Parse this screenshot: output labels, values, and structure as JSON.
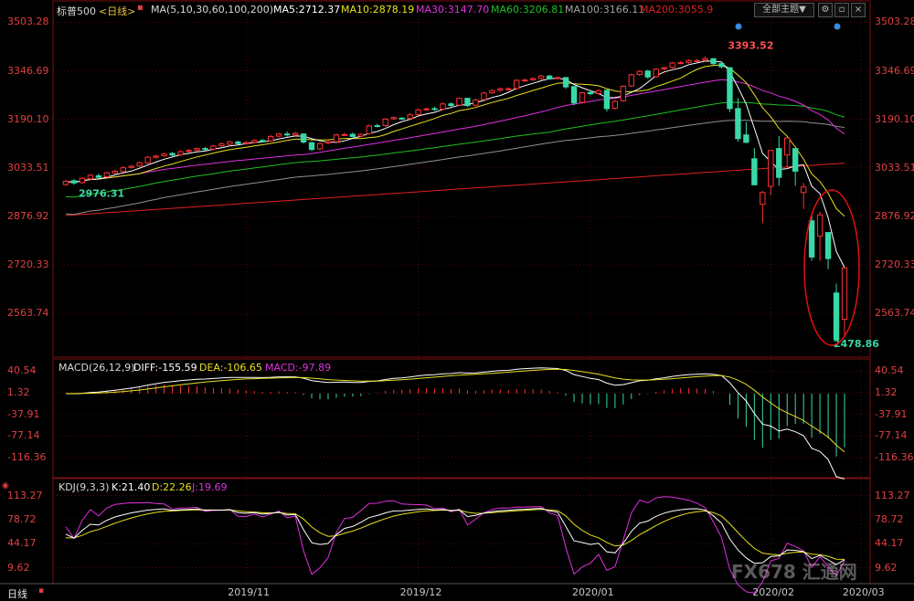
{
  "header": {
    "symbol": "标普500",
    "period": "<日线>",
    "ma_spec": "MA(5,10,30,60,100,200)",
    "ma5": "MA5:2712.37",
    "ma10": "MA10:2878.19",
    "ma30": "MA30:3147.70",
    "ma60": "MA60:3206.81",
    "ma100": "MA100:3166.11",
    "ma200": "MA200:3055.9",
    "theme_button": "全部主题",
    "theme_arrow": "▼"
  },
  "macd_header": {
    "spec": "MACD(26,12,9)",
    "diff": "DIFF:-155.59",
    "dea": "DEA:-106.65",
    "macd": "MACD:-97.89"
  },
  "kdj_header": {
    "spec": "KDJ(9,3,3)",
    "k": "K:21.40",
    "d": "D:22.26",
    "j": "J:19.69"
  },
  "footer": {
    "period_tab": "日线",
    "watermark": "FX678 汇通网"
  },
  "colors": {
    "up": "#ff3232",
    "down": "#38d8a8",
    "ma5": "#ffffff",
    "ma10": "#e8e020",
    "ma30": "#e030e0",
    "ma60": "#20c020",
    "ma100": "#909090",
    "ma200": "#e02020",
    "axis_text": "#e04040",
    "grid": "#7a1010"
  },
  "chart_data": [
    {
      "type": "candlestick",
      "title": "标普500 日线",
      "x": [
        "2019/11",
        "2019/12",
        "2020/01",
        "2020/02",
        "2020/03"
      ],
      "y_ticks": [
        3503.28,
        3346.69,
        3190.1,
        3033.51,
        2876.92,
        2720.33,
        2563.74
      ],
      "ylim": [
        2420,
        3540
      ],
      "annotations": [
        {
          "label": "3393.52",
          "value": 3393.52,
          "kind": "high"
        },
        {
          "label": "2976.31",
          "value": 2976.31,
          "kind": "low"
        },
        {
          "label": "2478.86",
          "value": 2478.86,
          "kind": "low"
        }
      ],
      "candles": [
        {
          "o": 2980,
          "c": 2990,
          "h": 2995,
          "l": 2976
        },
        {
          "o": 2992,
          "c": 2985,
          "h": 2998,
          "l": 2979
        },
        {
          "o": 2986,
          "c": 3000,
          "h": 3004,
          "l": 2983
        },
        {
          "o": 2998,
          "c": 3010,
          "h": 3014,
          "l": 2994
        },
        {
          "o": 3008,
          "c": 3003,
          "h": 3015,
          "l": 2999
        },
        {
          "o": 3005,
          "c": 3018,
          "h": 3022,
          "l": 3002
        },
        {
          "o": 3017,
          "c": 3023,
          "h": 3027,
          "l": 3013
        },
        {
          "o": 3022,
          "c": 3034,
          "h": 3039,
          "l": 3019
        },
        {
          "o": 3035,
          "c": 3039,
          "h": 3043,
          "l": 3031
        },
        {
          "o": 3040,
          "c": 3050,
          "h": 3054,
          "l": 3036
        },
        {
          "o": 3050,
          "c": 3068,
          "h": 3071,
          "l": 3046
        },
        {
          "o": 3068,
          "c": 3072,
          "h": 3076,
          "l": 3063
        },
        {
          "o": 3073,
          "c": 3079,
          "h": 3082,
          "l": 3069
        },
        {
          "o": 3080,
          "c": 3075,
          "h": 3085,
          "l": 3071
        },
        {
          "o": 3076,
          "c": 3086,
          "h": 3090,
          "l": 3072
        },
        {
          "o": 3088,
          "c": 3090,
          "h": 3094,
          "l": 3083
        },
        {
          "o": 3091,
          "c": 3096,
          "h": 3099,
          "l": 3087
        },
        {
          "o": 3096,
          "c": 3093,
          "h": 3101,
          "l": 3088
        },
        {
          "o": 3094,
          "c": 3104,
          "h": 3108,
          "l": 3090
        },
        {
          "o": 3105,
          "c": 3111,
          "h": 3115,
          "l": 3101
        },
        {
          "o": 3110,
          "c": 3118,
          "h": 3121,
          "l": 3106
        },
        {
          "o": 3117,
          "c": 3112,
          "h": 3122,
          "l": 3108
        },
        {
          "o": 3112,
          "c": 3115,
          "h": 3120,
          "l": 3108
        },
        {
          "o": 3116,
          "c": 3122,
          "h": 3126,
          "l": 3112
        },
        {
          "o": 3122,
          "c": 3120,
          "h": 3127,
          "l": 3116
        },
        {
          "o": 3121,
          "c": 3135,
          "h": 3140,
          "l": 3118
        },
        {
          "o": 3136,
          "c": 3143,
          "h": 3147,
          "l": 3132
        },
        {
          "o": 3143,
          "c": 3140,
          "h": 3151,
          "l": 3135
        },
        {
          "o": 3140,
          "c": 3145,
          "h": 3150,
          "l": 3136
        },
        {
          "o": 3143,
          "c": 3117,
          "h": 3145,
          "l": 3112
        },
        {
          "o": 3115,
          "c": 3093,
          "h": 3118,
          "l": 3088
        },
        {
          "o": 3095,
          "c": 3112,
          "h": 3116,
          "l": 3090
        },
        {
          "o": 3114,
          "c": 3118,
          "h": 3122,
          "l": 3110
        },
        {
          "o": 3118,
          "c": 3140,
          "h": 3144,
          "l": 3115
        },
        {
          "o": 3141,
          "c": 3141,
          "h": 3147,
          "l": 3136
        },
        {
          "o": 3142,
          "c": 3135,
          "h": 3148,
          "l": 3132
        },
        {
          "o": 3136,
          "c": 3142,
          "h": 3146,
          "l": 3132
        },
        {
          "o": 3144,
          "c": 3169,
          "h": 3173,
          "l": 3141
        },
        {
          "o": 3170,
          "c": 3168,
          "h": 3176,
          "l": 3164
        },
        {
          "o": 3170,
          "c": 3191,
          "h": 3195,
          "l": 3166
        },
        {
          "o": 3192,
          "c": 3196,
          "h": 3199,
          "l": 3188
        },
        {
          "o": 3194,
          "c": 3192,
          "h": 3198,
          "l": 3189
        },
        {
          "o": 3193,
          "c": 3205,
          "h": 3209,
          "l": 3190
        },
        {
          "o": 3206,
          "c": 3221,
          "h": 3225,
          "l": 3203
        },
        {
          "o": 3222,
          "c": 3224,
          "h": 3228,
          "l": 3219
        },
        {
          "o": 3225,
          "c": 3222,
          "h": 3231,
          "l": 3217
        },
        {
          "o": 3223,
          "c": 3240,
          "h": 3244,
          "l": 3220
        },
        {
          "o": 3240,
          "c": 3235,
          "h": 3245,
          "l": 3230
        },
        {
          "o": 3236,
          "c": 3258,
          "h": 3261,
          "l": 3233
        },
        {
          "o": 3258,
          "c": 3235,
          "h": 3260,
          "l": 3230
        },
        {
          "o": 3236,
          "c": 3253,
          "h": 3257,
          "l": 3232
        },
        {
          "o": 3254,
          "c": 3275,
          "h": 3279,
          "l": 3251
        },
        {
          "o": 3276,
          "c": 3283,
          "h": 3287,
          "l": 3272
        },
        {
          "o": 3284,
          "c": 3289,
          "h": 3293,
          "l": 3280
        },
        {
          "o": 3289,
          "c": 3289,
          "h": 3294,
          "l": 3284
        },
        {
          "o": 3290,
          "c": 3316,
          "h": 3320,
          "l": 3286
        },
        {
          "o": 3317,
          "c": 3317,
          "h": 3322,
          "l": 3312
        },
        {
          "o": 3318,
          "c": 3322,
          "h": 3326,
          "l": 3314
        },
        {
          "o": 3322,
          "c": 3330,
          "h": 3334,
          "l": 3318
        },
        {
          "o": 3330,
          "c": 3321,
          "h": 3334,
          "l": 3317
        },
        {
          "o": 3322,
          "c": 3325,
          "h": 3329,
          "l": 3318
        },
        {
          "o": 3325,
          "c": 3295,
          "h": 3327,
          "l": 3289
        },
        {
          "o": 3296,
          "c": 3243,
          "h": 3298,
          "l": 3236
        },
        {
          "o": 3245,
          "c": 3276,
          "h": 3279,
          "l": 3242
        },
        {
          "o": 3277,
          "c": 3273,
          "h": 3285,
          "l": 3268
        },
        {
          "o": 3274,
          "c": 3283,
          "h": 3287,
          "l": 3270
        },
        {
          "o": 3284,
          "c": 3225,
          "h": 3286,
          "l": 3215
        },
        {
          "o": 3226,
          "c": 3248,
          "h": 3253,
          "l": 3222
        },
        {
          "o": 3250,
          "c": 3297,
          "h": 3300,
          "l": 3247
        },
        {
          "o": 3298,
          "c": 3334,
          "h": 3338,
          "l": 3295
        },
        {
          "o": 3335,
          "c": 3345,
          "h": 3349,
          "l": 3331
        },
        {
          "o": 3346,
          "c": 3327,
          "h": 3350,
          "l": 3321
        },
        {
          "o": 3328,
          "c": 3352,
          "h": 3356,
          "l": 3324
        },
        {
          "o": 3353,
          "c": 3357,
          "h": 3361,
          "l": 3349
        },
        {
          "o": 3358,
          "c": 3372,
          "h": 3376,
          "l": 3354
        },
        {
          "o": 3373,
          "c": 3373,
          "h": 3378,
          "l": 3368
        },
        {
          "o": 3374,
          "c": 3380,
          "h": 3384,
          "l": 3370
        },
        {
          "o": 3380,
          "c": 3380,
          "h": 3385,
          "l": 3375
        },
        {
          "o": 3381,
          "c": 3386,
          "h": 3393.52,
          "l": 3377
        },
        {
          "o": 3386,
          "c": 3370,
          "h": 3388,
          "l": 3364
        },
        {
          "o": 3370,
          "c": 3360,
          "h": 3375,
          "l": 3355
        },
        {
          "o": 3357,
          "c": 3225,
          "h": 3358,
          "l": 3214
        },
        {
          "o": 3225,
          "c": 3128,
          "h": 3259,
          "l": 3118
        },
        {
          "o": 3140,
          "c": 3116,
          "h": 3182,
          "l": 3114
        },
        {
          "o": 3063,
          "c": 2979,
          "h": 3098,
          "l": 2977
        },
        {
          "o": 2916,
          "c": 2954,
          "h": 2959,
          "l": 2855
        },
        {
          "o": 2974,
          "c": 3090,
          "h": 3091,
          "l": 2945
        },
        {
          "o": 3096,
          "c": 3003,
          "h": 3136,
          "l": 2976
        },
        {
          "o": 3075,
          "c": 3130,
          "h": 3130,
          "l": 3034
        },
        {
          "o": 3096,
          "c": 3023,
          "h": 3097,
          "l": 2976
        },
        {
          "o": 2954,
          "c": 2972,
          "h": 2985,
          "l": 2901
        },
        {
          "o": 2863,
          "c": 2746,
          "h": 2882,
          "l": 2734
        },
        {
          "o": 2813,
          "c": 2882,
          "h": 2892,
          "l": 2734
        },
        {
          "o": 2825,
          "c": 2741,
          "h": 2825,
          "l": 2707
        },
        {
          "o": 2630,
          "c": 2480,
          "h": 2660,
          "l": 2478.86
        },
        {
          "o": 2545,
          "c": 2711,
          "h": 2711,
          "l": 2492
        }
      ]
    },
    {
      "type": "line",
      "title": "MACD(26,12,9)",
      "y_ticks": [
        40.54,
        1.32,
        -37.91,
        -77.14,
        -116.36
      ],
      "ylim": [
        -155,
        58
      ],
      "series": [
        {
          "name": "DIFF",
          "final": -155.59
        },
        {
          "name": "DEA",
          "final": -106.65
        },
        {
          "name": "MACD",
          "final": -97.89
        }
      ]
    },
    {
      "type": "line",
      "title": "KDJ(9,3,3)",
      "y_ticks": [
        113.27,
        78.72,
        44.17,
        9.62
      ],
      "ylim": [
        -12,
        130
      ],
      "series": [
        {
          "name": "K",
          "final": 21.4
        },
        {
          "name": "D",
          "final": 22.26
        },
        {
          "name": "J",
          "final": 19.69
        }
      ]
    }
  ]
}
